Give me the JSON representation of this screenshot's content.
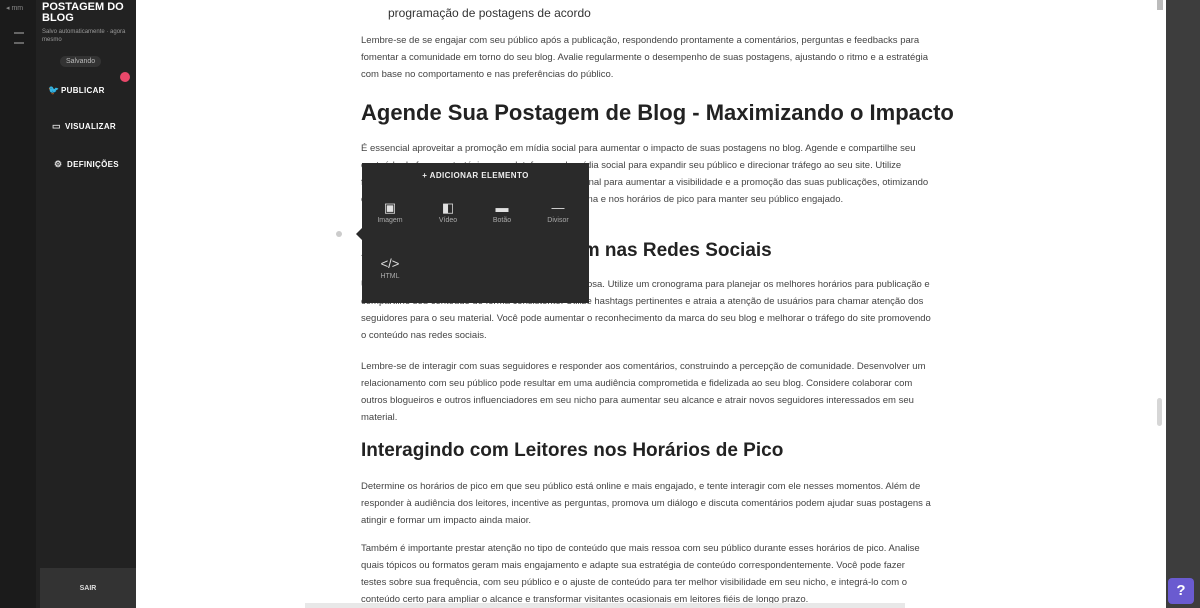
{
  "sidebar": {
    "back_label": "◂ mm",
    "title": "POSTAGEM DO BLOG",
    "subtitle": "Salvo automaticamente · agora mesmo",
    "status_pill": "Salvando",
    "items": [
      {
        "label": "PUBLICAR",
        "icon": "twitter-icon"
      },
      {
        "label": "VISUALIZAR",
        "icon": "monitor-icon"
      },
      {
        "label": "DEFINIÇÕES",
        "icon": "gear-icon"
      }
    ],
    "footer_label": "SAIR"
  },
  "article": {
    "fragment_top": "programação de postagens de acordo",
    "para1": "Lembre-se de se engajar com seu público após a publicação, respondendo prontamente a comentários, perguntas e feedbacks para fomentar a comunidade em torno do seu blog. Avalie regularmente o desempenho de suas postagens, ajustando o ritmo e a estratégia com base no comportamento e nas preferências do público.",
    "heading1": "Agende Sua Postagem de Blog - Maximizando o Impacto",
    "para2": "É essencial aproveitar a promoção em mídia social para aumentar o impacto de suas postagens no blog. Agende e compartilhe seu conteúdo de forma estratégica nas plataformas de mídia social para expandir seu público e direcionar tráfego ao seu site. Utilize ferramentas de agendamento e recursos de pico sazonal para aumentar a visibilidade e a promoção das suas publicações, otimizando com comentários e novas discussões durante a semana e nos horários de pico para manter seu público engajado.",
    "heading2": "Agendando sua Postagem nas Redes Sociais",
    "para3": "Utilizar a mídia social pode ser uma ferramenta poderosa. Utilize um cronograma para planejar os melhores horários para publicação e compartilhe seu conteúdo de forma consistente. Utilize hashtags pertinentes e atraia a atenção de usuários para chamar atenção dos seguidores para o seu material. Você pode aumentar o reconhecimento da marca do seu blog e melhorar o tráfego do site promovendo o conteúdo nas redes sociais.",
    "para4": "Lembre-se de interagir com suas seguidores e responder aos comentários, construindo a percepção de comunidade. Desenvolver um relacionamento com seu público pode resultar em uma audiência comprometida e fidelizada ao seu blog. Considere colaborar com outros blogueiros e outros influenciadores em seu nicho para aumentar seu alcance e atrair novos seguidores interessados em seu material.",
    "heading3": "Interagindo com Leitores nos Horários de Pico",
    "para5": "Determine os horários de pico em que seu público está online e mais engajado, e tente interagir com ele nesses momentos. Além de responder à audiência dos leitores, incentive as perguntas, promova um diálogo e discuta comentários podem ajudar suas postagens a atingir e formar um impacto ainda maior.",
    "para6": "Também é importante prestar atenção no tipo de conteúdo que mais ressoa com seu público durante esses horários de pico. Analise quais tópicos ou formatos geram mais engajamento e adapte sua estratégia de conteúdo correspondentemente. Você pode fazer testes sobre sua frequência, com seu público e o ajuste de conteúdo para ter melhor visibilidade em seu nicho, e integrá-lo com o conteúdo certo para ampliar o alcance e transformar visitantes ocasionais em leitores fiéis de longo prazo."
  },
  "add_panel": {
    "title": "+ ADICIONAR ELEMENTO",
    "tools": [
      {
        "label": "Imagem",
        "icon": "image-icon"
      },
      {
        "label": "Vídeo",
        "icon": "video-icon"
      },
      {
        "label": "Botão",
        "icon": "button-icon"
      },
      {
        "label": "Divisor",
        "icon": "divider-icon"
      },
      {
        "label": "HTML",
        "icon": "code-icon"
      }
    ]
  },
  "help": {
    "label": "?"
  },
  "colors": {
    "sidebar": "#222222",
    "panel": "#2a2a2a",
    "notification": "#e8486a",
    "help": "#6a5bd0"
  }
}
